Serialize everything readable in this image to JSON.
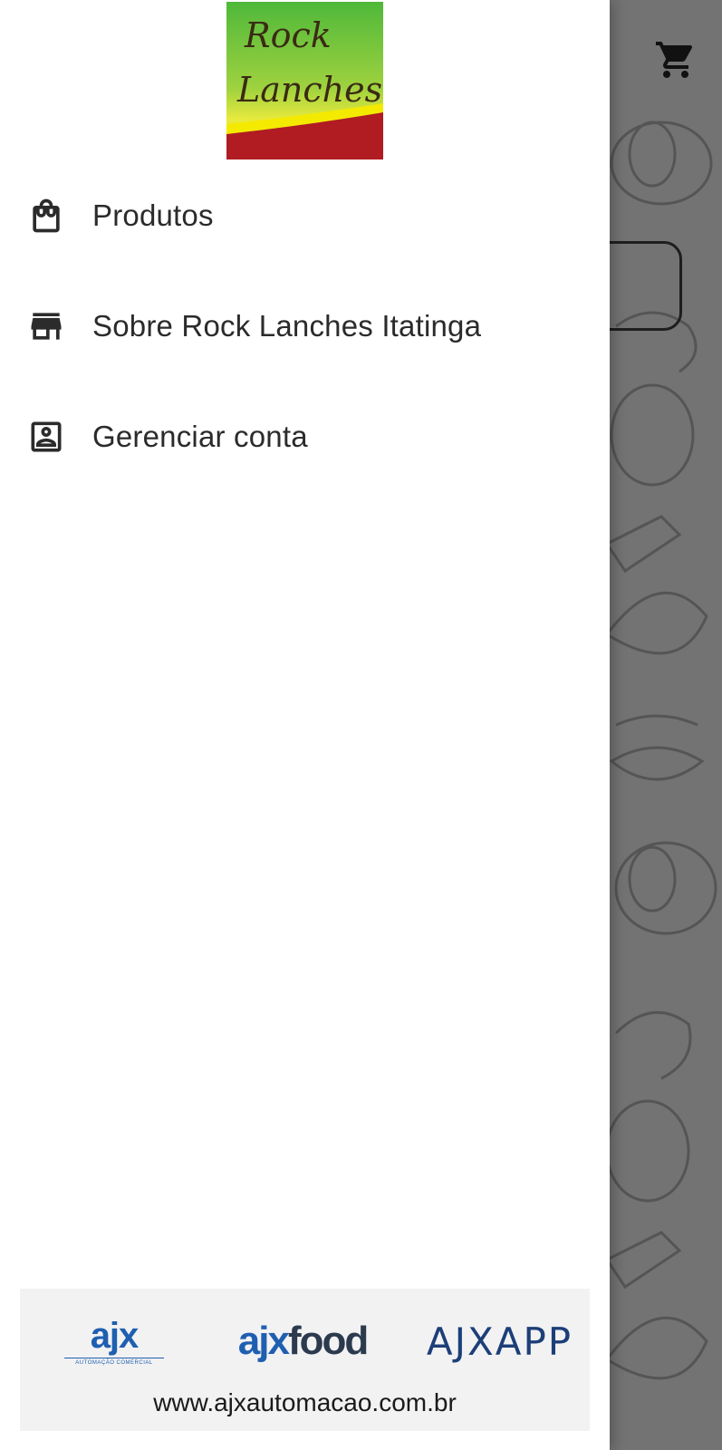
{
  "app": {
    "logo_line1": "Rock",
    "logo_line2": "Lanches"
  },
  "drawer": {
    "menu": [
      {
        "label": "Produtos",
        "icon": "shopping-bag-icon"
      },
      {
        "label": "Sobre Rock Lanches Itatinga",
        "icon": "store-icon"
      },
      {
        "label": "Gerenciar conta",
        "icon": "account-box-icon"
      }
    ],
    "footer": {
      "logo1_main": "ajx",
      "logo1_sub": "AUTOMAÇÃO COMERCIAL",
      "logo2_ajx": "ajx",
      "logo2_food": "food",
      "logo3": "AJXAPP",
      "url": "www.ajxautomacao.com.br"
    }
  },
  "background": {
    "cart_icon": "shopping-cart-icon"
  },
  "colors": {
    "brand_blue": "#1f5fb0",
    "logo_green": "#5cbf3a",
    "logo_yellow": "#f2e600",
    "logo_red": "#b11c22"
  }
}
